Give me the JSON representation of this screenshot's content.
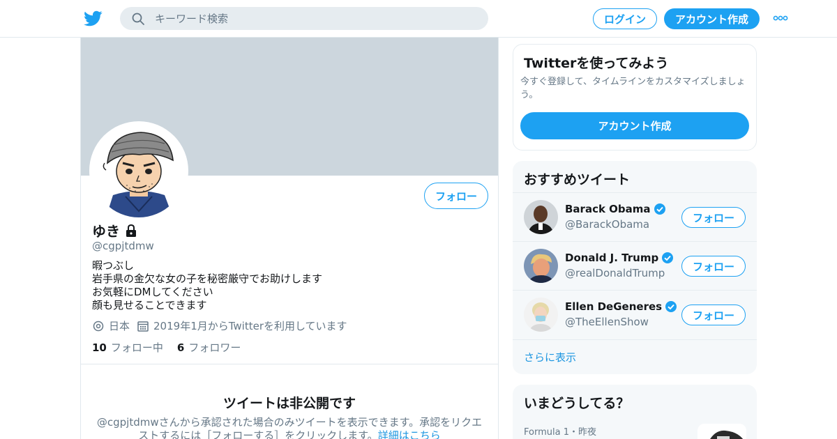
{
  "nav": {
    "search_placeholder": "キーワード検索",
    "login_label": "ログイン",
    "signup_label": "アカウント作成"
  },
  "profile": {
    "name": "ゆき",
    "handle": "@cgpjtdmw",
    "bio": [
      "暇つぶし",
      "岩手県の金欠な女の子を秘密厳守でお助けします",
      "お気軽にDMしてください",
      "顔も見せることできます"
    ],
    "location": "日本",
    "joined": "2019年1月からTwitterを利用しています",
    "following_count": "10",
    "following_label": "フォロー中",
    "followers_count": "6",
    "followers_label": "フォロワー",
    "follow_button": "フォロー",
    "private_title": "ツイートは非公開です",
    "private_desc": "@cgpjtdmwさんから承認された場合のみツイートを表示できます。承認をリクエストするには［フォローする］をクリックします。",
    "private_link": "詳細はこちら"
  },
  "signup_card": {
    "title": "Twitterを使ってみよう",
    "desc": "今すぐ登録して、タイムラインをカスタマイズしましょう。",
    "button": "アカウント作成"
  },
  "recommend": {
    "title": "おすすめツイート",
    "follow_label": "フォロー",
    "items": [
      {
        "name": "Barack Obama",
        "handle": "@BarackObama"
      },
      {
        "name": "Donald J. Trump",
        "handle": "@realDonaldTrump"
      },
      {
        "name": "Ellen DeGeneres",
        "handle": "@TheEllenShow"
      }
    ],
    "show_more": "さらに表示"
  },
  "trends": {
    "title": "いまどうしてる？",
    "item_meta": "Formula 1・昨夜"
  },
  "colors": {
    "brand": "#1da1f2",
    "banner": "#ccd6dd",
    "secondary_text": "#657786"
  }
}
